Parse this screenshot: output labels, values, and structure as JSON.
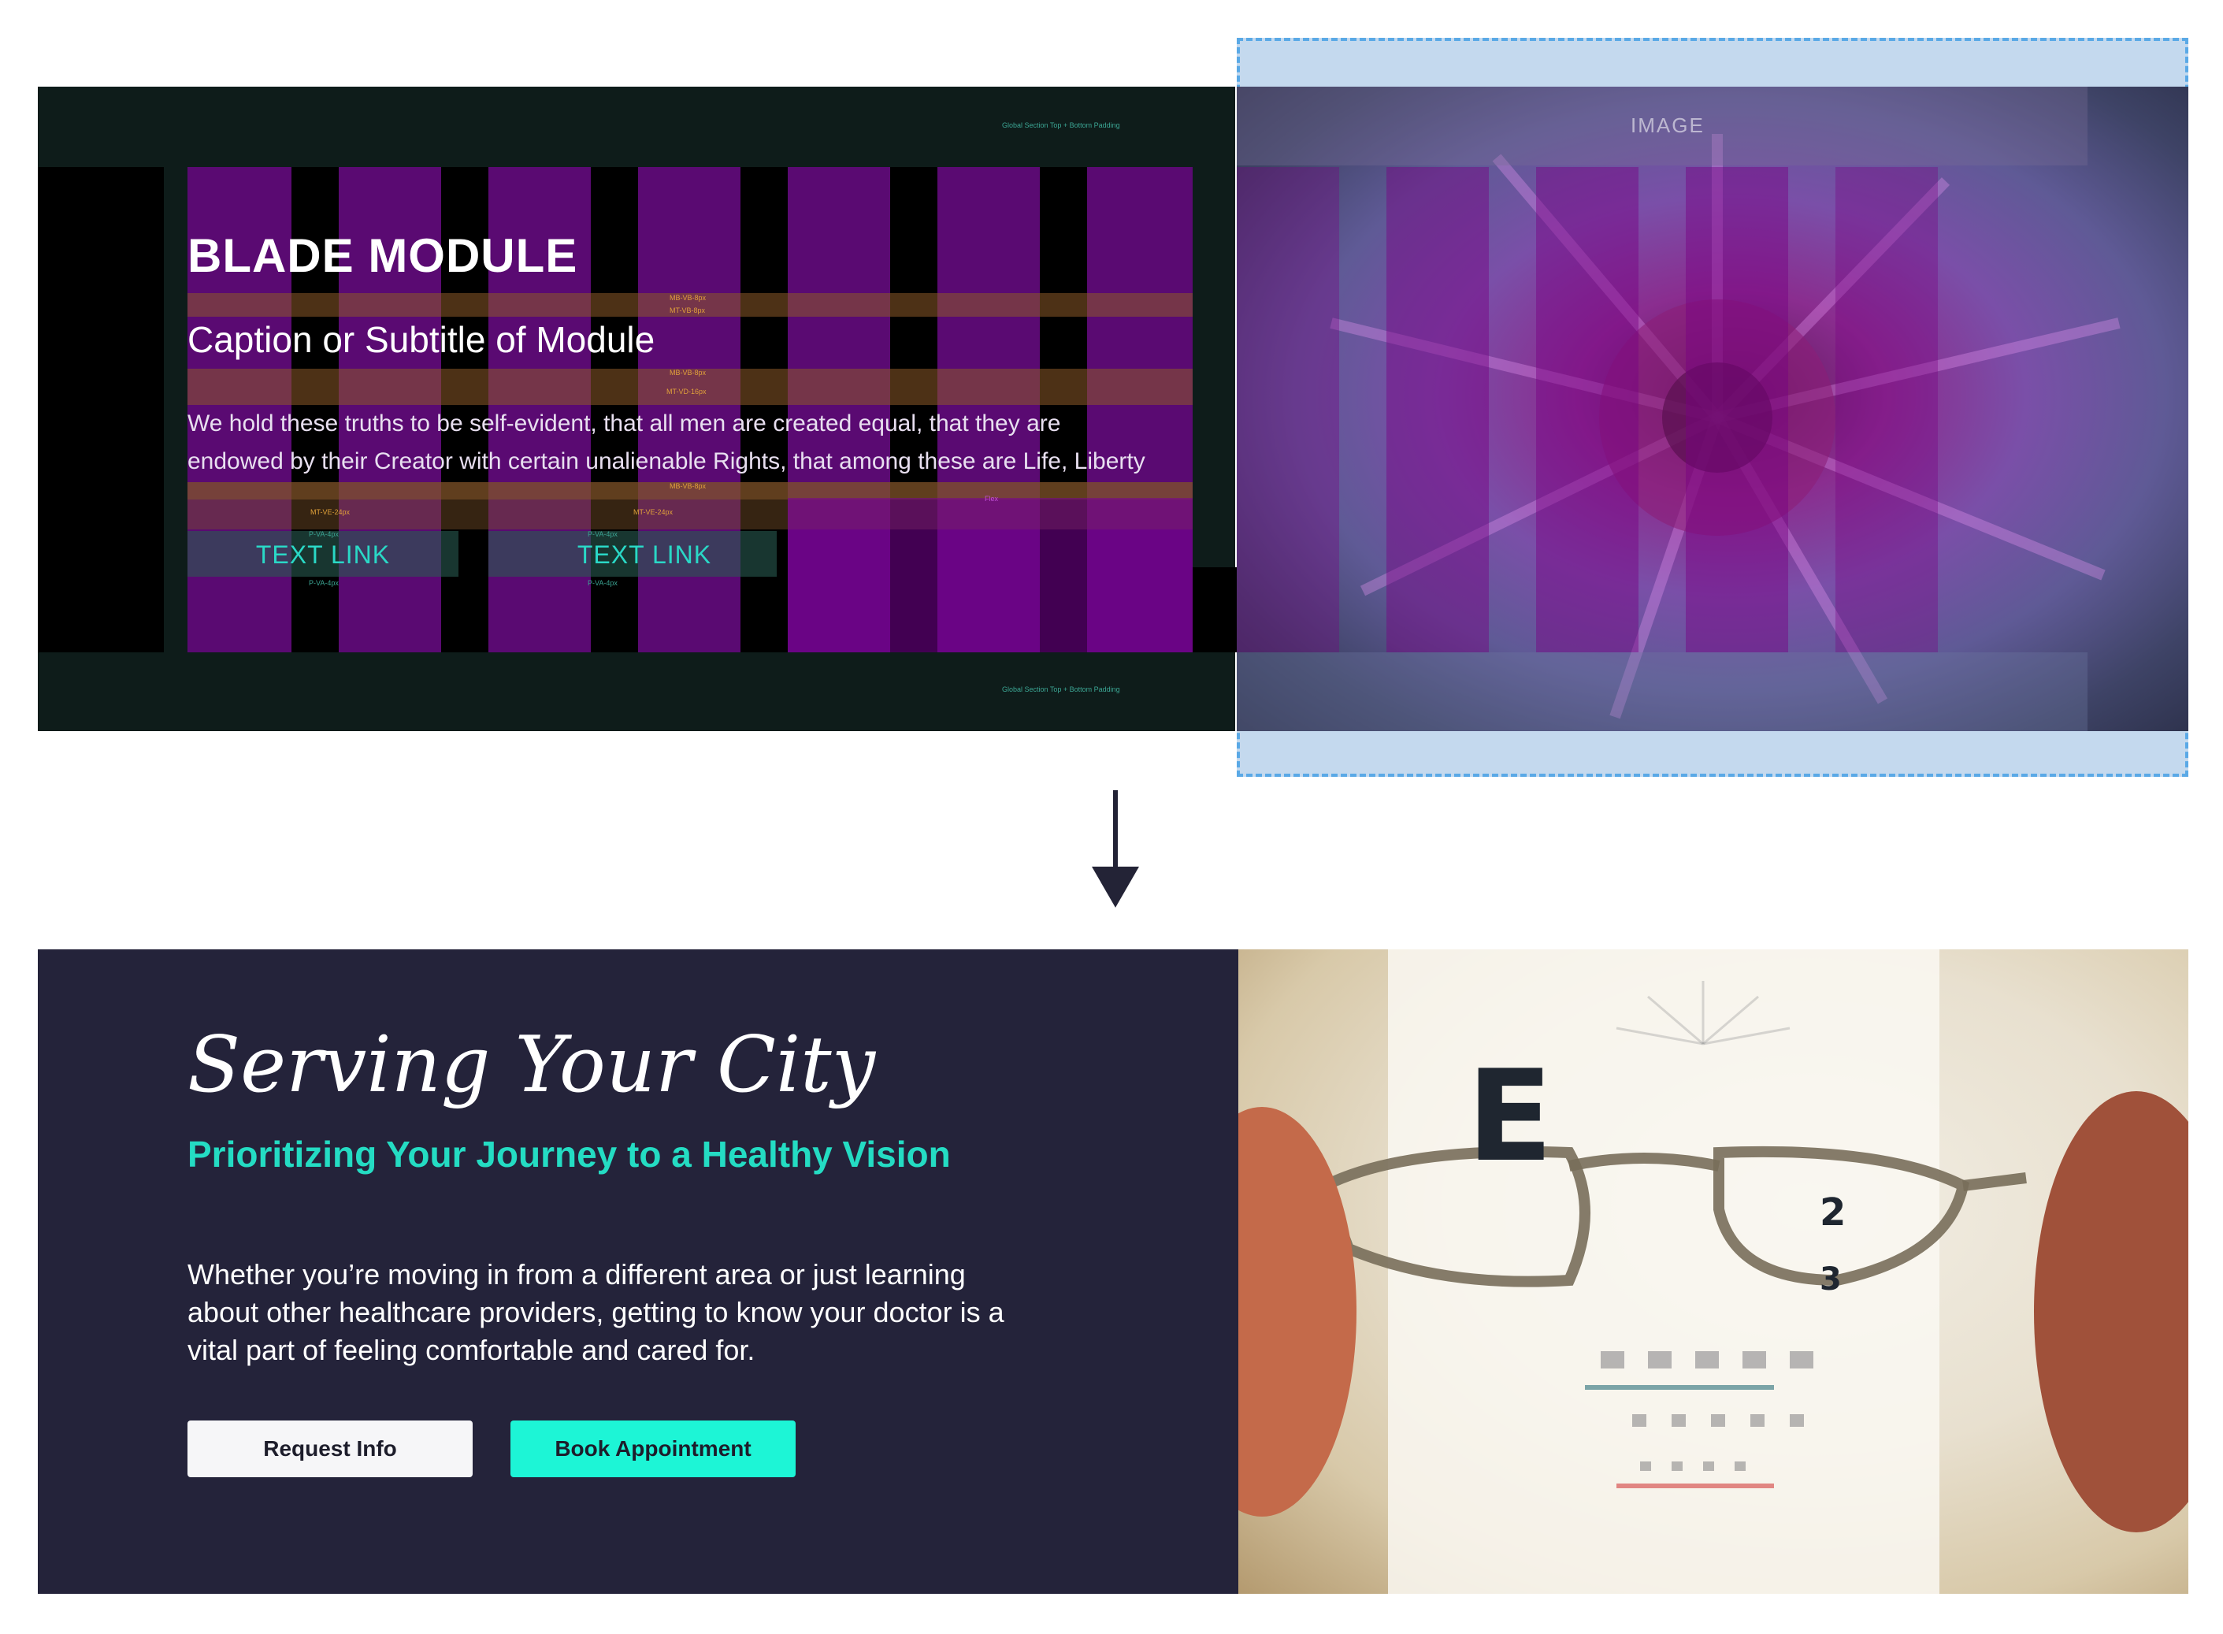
{
  "top_module": {
    "title": "BLADE MODULE",
    "subtitle": "Caption or Subtitle of Module",
    "body_line1": "We hold these truths to be self-evident, that all men are created equal, that they are",
    "body_line2": "endowed by their Creator with certain unalienable Rights, that among these are Life, Liberty",
    "link1": "TEXT LINK",
    "link2": "TEXT LINK",
    "padding_note_top": "Global Section Top + Bottom Padding",
    "padding_note_bottom": "Global Section Top + Bottom Padding",
    "image_label": "IMAGE",
    "annotations": {
      "mb_vb_8a": "MB-VB-8px",
      "mt_vb_8": "MT-VB-8px",
      "mb_vb_8b": "MB-VB-8px",
      "mt_vd_16": "MT-VD-16px",
      "mb_vb_8c": "MB-VB-8px",
      "mt_ve_24a": "MT-VE-24px",
      "mt_ve_24b": "MT-VE-24px",
      "p_va_4a": "P-VA-4px",
      "p_va_4b": "P-VA-4px",
      "p_va_4c": "P-VA-4px",
      "p_va_4d": "P-VA-4px",
      "flex": "Flex"
    }
  },
  "bottom_module": {
    "title": "Serving Your City",
    "subtitle": "Prioritizing Your Journey to a Healthy Vision",
    "body_line1": "Whether you’re moving in from a different area or just learning",
    "body_line2": "about other healthcare providers, getting to know your doctor is a",
    "body_line3": "vital part of feeling comfortable and cared for.",
    "button_request": "Request Info",
    "button_book": "Book Appointment"
  },
  "eye_chart": {
    "big_letter": "E",
    "row_right": "2",
    "row_right_partial": "3"
  },
  "colors": {
    "top_bg": "#0e1c1a",
    "overlay_purple": "#5a0a72",
    "link_teal": "#2ad8c6",
    "bottom_bg": "#24233a",
    "subtitle_teal": "#24dcc3",
    "book_button": "#1df5d6",
    "image_selection_border": "#5aa9e6"
  }
}
